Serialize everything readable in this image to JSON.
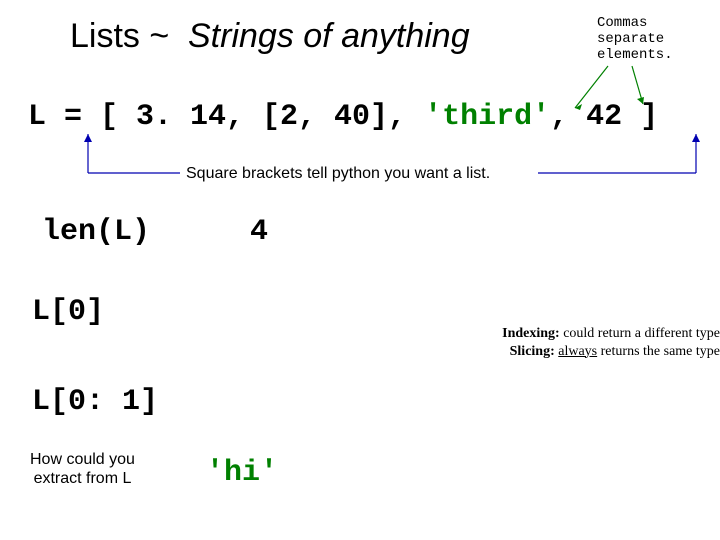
{
  "title": {
    "a": "Lists ~ ",
    "b": "Strings of anything"
  },
  "topnote": {
    "l1": "Commas",
    "l2": "separate",
    "l3": "elements."
  },
  "code": {
    "pre": "L = [ 3. 14, [2, 40], ",
    "str": "'third'",
    "post": ", 42 ]"
  },
  "bracketcap": "Square brackets tell python you want a list.",
  "len": {
    "call": "len(L)",
    "result": "4"
  },
  "idx0": "L[0]",
  "slice01": "L[0: 1]",
  "right": {
    "idx_b": "Indexing:",
    "idx_t": " could return a different type",
    "slc_b": "Slicing:",
    "slc_t": " returns the same type",
    "always": "always"
  },
  "extract": {
    "l1": "How could you",
    "l2": "extract from L"
  },
  "hi": "'hi'"
}
